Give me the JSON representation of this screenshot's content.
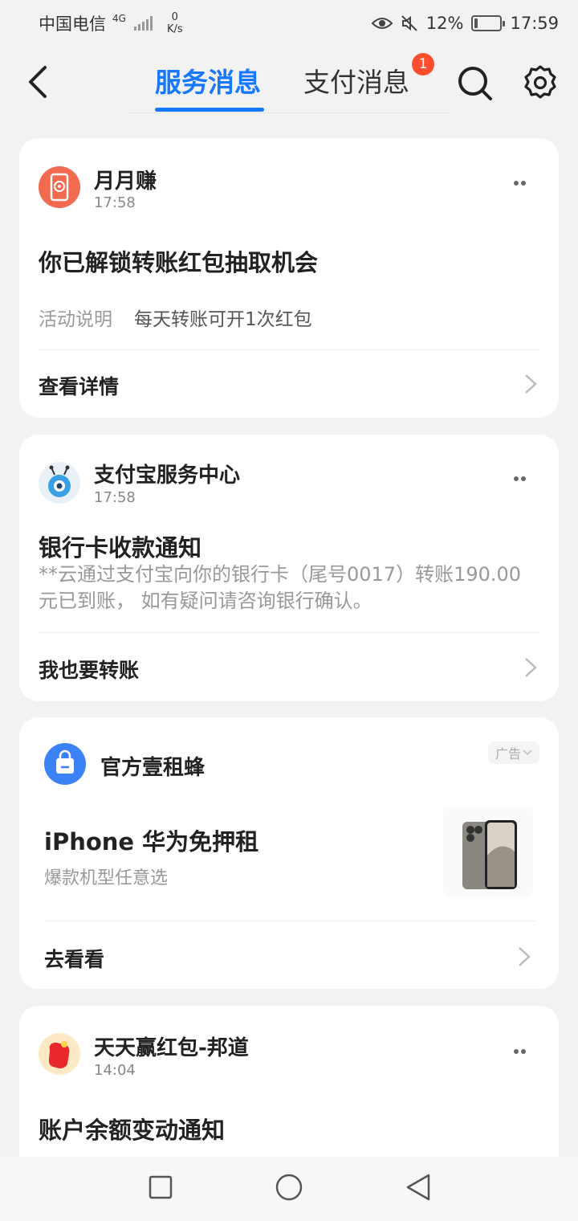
{
  "status_bar": {
    "carrier": "中国电信",
    "network": "4G",
    "speed_value": "0",
    "speed_unit": "K/s",
    "battery": "12%",
    "time": "17:59",
    "battery_level": 0.12
  },
  "nav": {
    "tab_service": "服务消息",
    "tab_payment": "支付消息",
    "payment_badge": "1"
  },
  "cards": [
    {
      "sender": "月月赚",
      "time": "17:58",
      "title": "你已解锁转账红包抽取机会",
      "detail_label": "活动说明",
      "detail_value": "每天转账可开1次红包",
      "action": "查看详情"
    },
    {
      "sender": "支付宝服务中心",
      "time": "17:58",
      "title": "银行卡收款通知",
      "body": "**云通过支付宝向你的银行卡（尾号0017）转账190.00元已到账， 如有疑问请咨询银行确认。",
      "action": "我也要转账"
    },
    {
      "sender": "官方壹租蜂",
      "ad_label": "广告",
      "title": "iPhone 华为免押租",
      "subtitle": "爆款机型任意选",
      "action": "去看看"
    },
    {
      "sender": "天天赢红包-邦道",
      "time": "14:04",
      "title": "账户余额变动通知"
    }
  ]
}
